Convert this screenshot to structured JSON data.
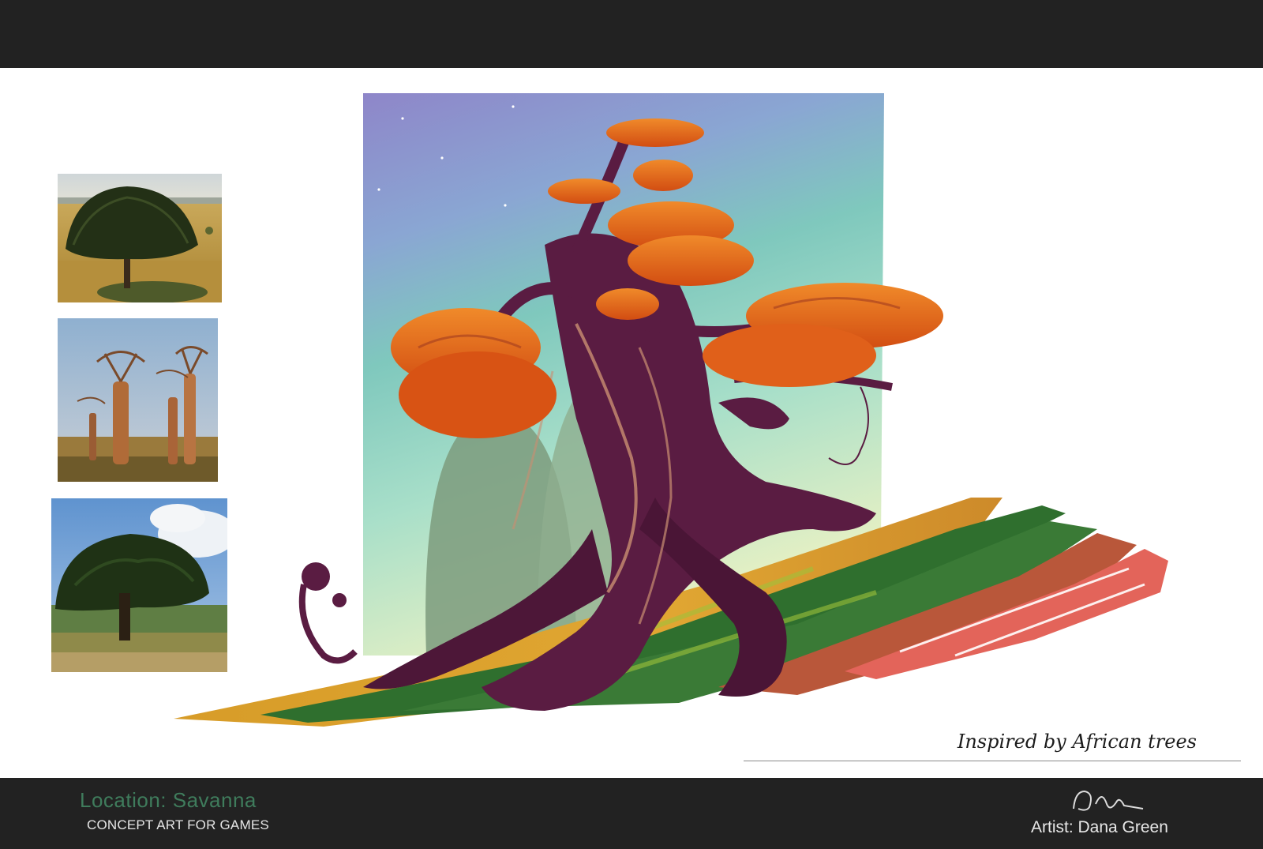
{
  "caption": "Inspired by African trees",
  "footer": {
    "location": "Location: Savanna",
    "subtitle": "CONCEPT ART FOR GAMES",
    "artist": "Artist: Dana Green"
  },
  "references": [
    {
      "icon": "candelabra-tree-photo"
    },
    {
      "icon": "baobab-trees-photo"
    },
    {
      "icon": "acacia-tree-photo"
    }
  ],
  "colors": {
    "bars": "#222222",
    "location_text": "#3f7c5c",
    "foliage": "#e8671c",
    "trunk": "#5a1c42"
  }
}
